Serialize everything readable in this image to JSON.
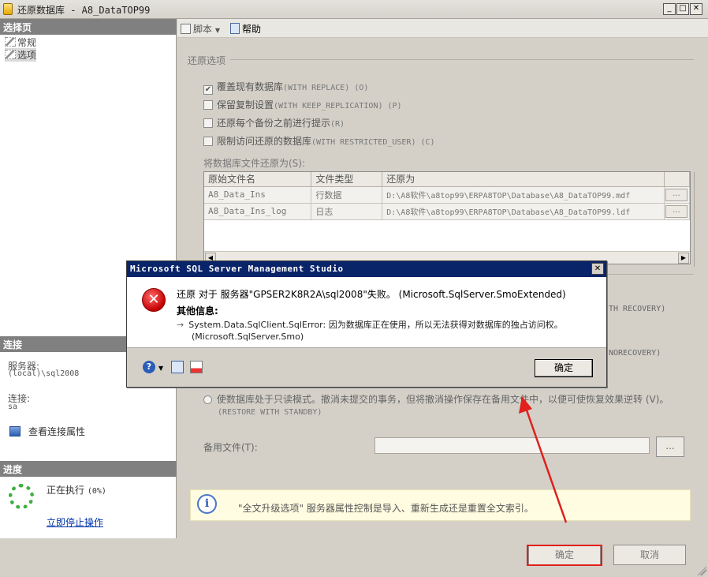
{
  "window": {
    "title": "还原数据库 - A8_DataTOP99",
    "min": "_",
    "max": "□",
    "close": "✕"
  },
  "left": {
    "select_page_header": "选择页",
    "pages": [
      {
        "label": "常规"
      },
      {
        "label": "选项"
      }
    ],
    "connection_header": "连接",
    "server_label": "服务器:",
    "server_value": "(local)\\sql2008",
    "conn_label": "连接:",
    "conn_value": "sa",
    "view_conn_props": "查看连接属性",
    "progress_header": "进度",
    "progress_status": "正在执行",
    "progress_pct": "(0%)",
    "stop_link": "立即停止操作"
  },
  "toolbar": {
    "script": "脚本",
    "help": "帮助"
  },
  "options": {
    "group_title": "还原选项",
    "checkboxes": [
      {
        "label": "覆盖现有数据库",
        "sub": "(WITH REPLACE) (O)",
        "checked": true
      },
      {
        "label": "保留复制设置",
        "sub": "(WITH KEEP_REPLICATION) (P)",
        "checked": false
      },
      {
        "label": "还原每个备份之前进行提示",
        "sub": "(R)",
        "checked": false
      },
      {
        "label": "限制访问还原的数据库",
        "sub": "(WITH RESTRICTED_USER) (C)",
        "checked": false
      }
    ],
    "restore_files_label": "将数据库文件还原为(S):",
    "columns": [
      "原始文件名",
      "文件类型",
      "还原为"
    ],
    "rows": [
      {
        "name": "A8_Data_Ins",
        "type": "行数据",
        "path": "D:\\A8软件\\a8top99\\ERPA8TOP\\Database\\A8_DataTOP99.mdf",
        "btn": "..."
      },
      {
        "name": "A8_Data_Ins_log",
        "type": "日志",
        "path": "D:\\A8软件\\a8top99\\ERPA8TOP\\Database\\A8_DataTOP99.ldf",
        "btn": "..."
      }
    ],
    "scroll_left": "◀",
    "scroll_right": "▶",
    "suffix_recovery": "TH RECOVERY)",
    "suffix_norecovery": "NORECOVERY)",
    "standby_text": "使数据库处于只读模式。撤消未提交的事务，但将撤消操作保存在备用文件中，以便可使恢复效果逆转 (V)。",
    "standby_sub": "(RESTORE WITH STANDBY)",
    "backup_file_label": "备用文件(T):",
    "backup_btn": "...",
    "info_icon": "i",
    "info_text": "\"全文升级选项\" 服务器属性控制是导入、重新生成还是重置全文索引。",
    "ok": "确定",
    "cancel": "取消"
  },
  "dialog": {
    "title": "Microsoft SQL Server Management Studio",
    "close": "✕",
    "error_icon": "✕",
    "message": "还原 对于 服务器\"GPSER2K8R2A\\sql2008\"失败。 (Microsoft.SqlServer.SmoExtended)",
    "extra_header": "其他信息:",
    "detail_arrow": "→",
    "detail_1": "System.Data.SqlClient.SqlError: 因为数据库正在使用，所以无法获得对数据库的独占访问权。",
    "detail_2": "(Microsoft.SqlServer.Smo)",
    "ok": "确定"
  },
  "colors": {
    "dialog_title_bg": "#0a246a",
    "error_red": "#c40000",
    "highlight_red": "#e0201c",
    "info_bg": "#fffce1"
  }
}
